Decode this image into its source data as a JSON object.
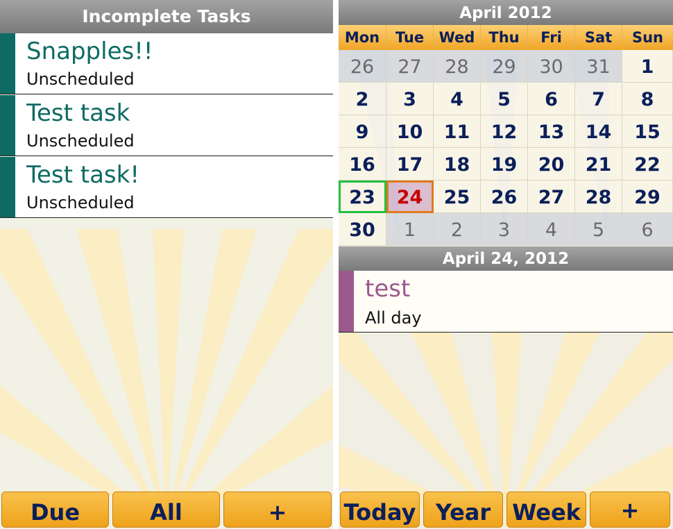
{
  "tasks_panel": {
    "title": "Incomplete Tasks",
    "tasks": [
      {
        "title": "Snapples!!",
        "status": "Unscheduled"
      },
      {
        "title": "Test task",
        "status": "Unscheduled"
      },
      {
        "title": "Test task!",
        "status": "Unscheduled"
      }
    ],
    "buttons": {
      "due": "Due",
      "all": "All",
      "add": "+"
    }
  },
  "calendar_panel": {
    "month_title": "April 2012",
    "weekdays": [
      "Mon",
      "Tue",
      "Wed",
      "Thu",
      "Fri",
      "Sat",
      "Sun"
    ],
    "weeks": [
      [
        "26",
        "27",
        "28",
        "29",
        "30",
        "31",
        "1"
      ],
      [
        "2",
        "3",
        "4",
        "5",
        "6",
        "7",
        "8"
      ],
      [
        "9",
        "10",
        "11",
        "12",
        "13",
        "14",
        "15"
      ],
      [
        "16",
        "17",
        "18",
        "19",
        "20",
        "21",
        "22"
      ],
      [
        "23",
        "24",
        "25",
        "26",
        "27",
        "28",
        "29"
      ],
      [
        "30",
        "1",
        "2",
        "3",
        "4",
        "5",
        "6"
      ]
    ],
    "selected_date_title": "April 24, 2012",
    "event": {
      "title": "test",
      "time": "All day"
    },
    "buttons": {
      "today": "Today",
      "year": "Year",
      "week": "Week",
      "add": "+"
    }
  },
  "colors": {
    "task_accent": "#0e6b64",
    "event_accent": "#9b5a8c",
    "button_orange": "#f2ac2c",
    "button_text": "#0b1f5a",
    "today_border": "#e07a1e",
    "selected_border": "#22c040"
  }
}
